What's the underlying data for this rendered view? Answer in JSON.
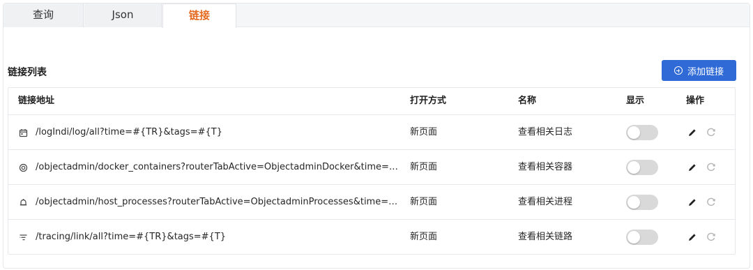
{
  "tabs": [
    {
      "label": "查询"
    },
    {
      "label": "Json"
    },
    {
      "label": "链接",
      "active": true
    }
  ],
  "section": {
    "title": "链接列表",
    "add_button_label": "添加链接",
    "add_button_icon": "plus-circle-icon"
  },
  "table": {
    "columns": [
      "链接地址",
      "打开方式",
      "名称",
      "显示",
      "操作"
    ],
    "rows": [
      {
        "icon": "calendar-icon",
        "url": "/logIndi/log/all?time=#{TR}&tags=#{T}",
        "open_mode": "新页面",
        "name": "查看相关日志",
        "shown": false
      },
      {
        "icon": "target-icon",
        "url": "/objectadmin/docker_containers?routerTabActive=ObjectadminDocker&time=#{TR}…",
        "open_mode": "新页面",
        "name": "查看相关容器",
        "shown": false
      },
      {
        "icon": "bell-icon",
        "url": "/objectadmin/host_processes?routerTabActive=ObjectadminProcesses&time=#{TR…",
        "open_mode": "新页面",
        "name": "查看相关进程",
        "shown": false
      },
      {
        "icon": "trace-icon",
        "url": "/tracing/link/all?time=#{TR}&tags=#{T}",
        "open_mode": "新页面",
        "name": "查看相关链路",
        "shown": false
      }
    ]
  },
  "colors": {
    "accent": "#e56a1f",
    "primary_button": "#2f6ad7",
    "toggle_off": "#d9d9d9"
  }
}
